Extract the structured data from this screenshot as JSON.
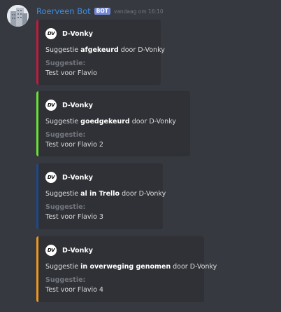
{
  "message": {
    "username": "Roerveen Bot",
    "badge": "BOT",
    "timestamp": "vandaag om 16:10"
  },
  "embeds": [
    {
      "color": "#c31a3d",
      "author": "D-Vonky",
      "author_icon": "DV",
      "desc_prefix": "Suggestie ",
      "desc_bold": "afgekeurd",
      "desc_suffix": " door D-Vonky",
      "field_name": "Suggestie:",
      "field_value": "Test voor Flavio"
    },
    {
      "color": "#69e334",
      "author": "D-Vonky",
      "author_icon": "DV",
      "desc_prefix": "Suggestie ",
      "desc_bold": "goedgekeurd",
      "desc_suffix": " door D-Vonky",
      "field_name": "Suggestie:",
      "field_value": "Test voor Flavio 2"
    },
    {
      "color": "#1d4a8b",
      "author": "D-Vonky",
      "author_icon": "DV",
      "desc_prefix": "Suggestie ",
      "desc_bold": "al in Trello",
      "desc_suffix": " door D-Vonky",
      "field_name": "Suggestie:",
      "field_value": "Test voor Flavio 3"
    },
    {
      "color": "#f09720",
      "author": "D-Vonky",
      "author_icon": "DV",
      "desc_prefix": "Suggestie ",
      "desc_bold": "in overweging genomen",
      "desc_suffix": " door D-Vonky",
      "field_name": "Suggestie:",
      "field_value": "Test voor Flavio 4"
    }
  ]
}
